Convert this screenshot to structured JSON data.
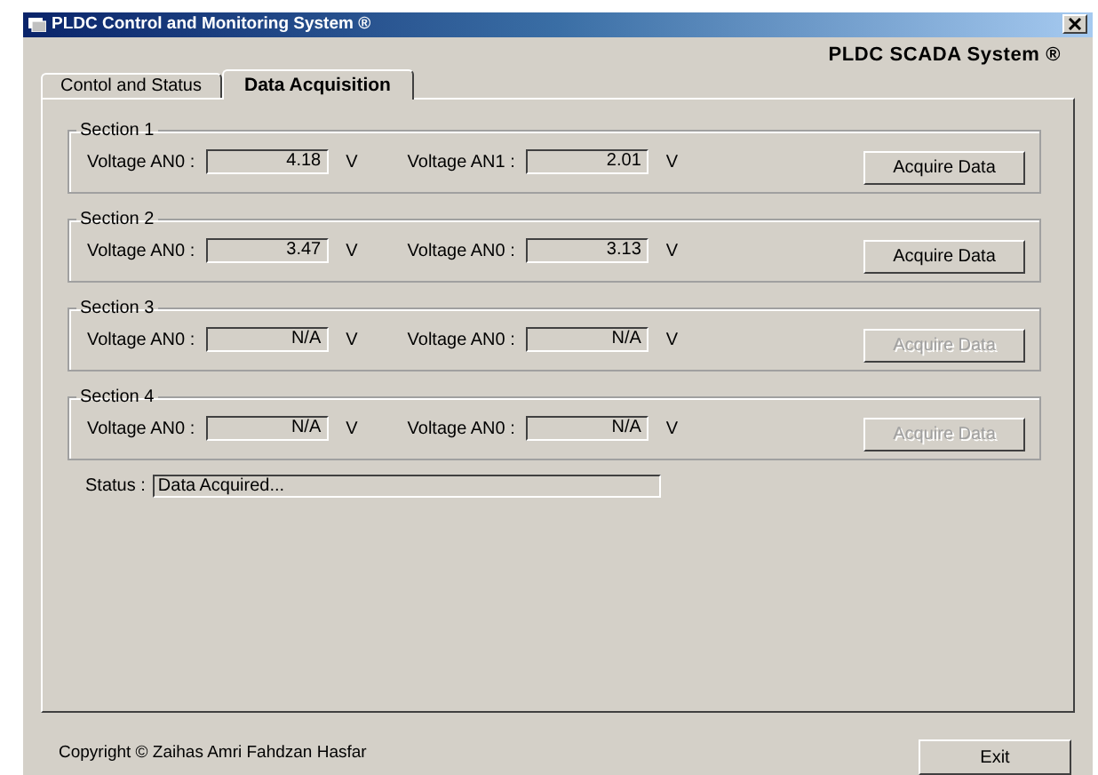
{
  "window": {
    "title": "PLDC Control and Monitoring System ®"
  },
  "header": "PLDC SCADA System ®",
  "tabs": [
    {
      "label": "Contol and Status",
      "selected": false
    },
    {
      "label": "Data Acquisition",
      "selected": true
    }
  ],
  "sections": [
    {
      "title": "Section 1",
      "readings": [
        {
          "label": "Voltage AN0 :",
          "value": "4.18",
          "unit": "V"
        },
        {
          "label": "Voltage AN1 :",
          "value": "2.01",
          "unit": "V"
        }
      ],
      "button": {
        "label": "Acquire Data",
        "disabled": false
      }
    },
    {
      "title": "Section 2",
      "readings": [
        {
          "label": "Voltage AN0 :",
          "value": "3.47",
          "unit": "V"
        },
        {
          "label": "Voltage AN0 :",
          "value": "3.13",
          "unit": "V"
        }
      ],
      "button": {
        "label": "Acquire Data",
        "disabled": false
      }
    },
    {
      "title": "Section 3",
      "readings": [
        {
          "label": "Voltage AN0 :",
          "value": "N/A",
          "unit": "V"
        },
        {
          "label": "Voltage AN0 :",
          "value": "N/A",
          "unit": "V"
        }
      ],
      "button": {
        "label": "Acquire Data",
        "disabled": true
      }
    },
    {
      "title": "Section 4",
      "readings": [
        {
          "label": "Voltage AN0 :",
          "value": "N/A",
          "unit": "V"
        },
        {
          "label": "Voltage AN0 :",
          "value": "N/A",
          "unit": "V"
        }
      ],
      "button": {
        "label": "Acquire Data",
        "disabled": true
      }
    }
  ],
  "status": {
    "label": "Status :",
    "value": "Data Acquired..."
  },
  "footer": {
    "copyright": "Copyright © Zaihas Amri Fahdzan Hasfar",
    "exit": "Exit"
  }
}
